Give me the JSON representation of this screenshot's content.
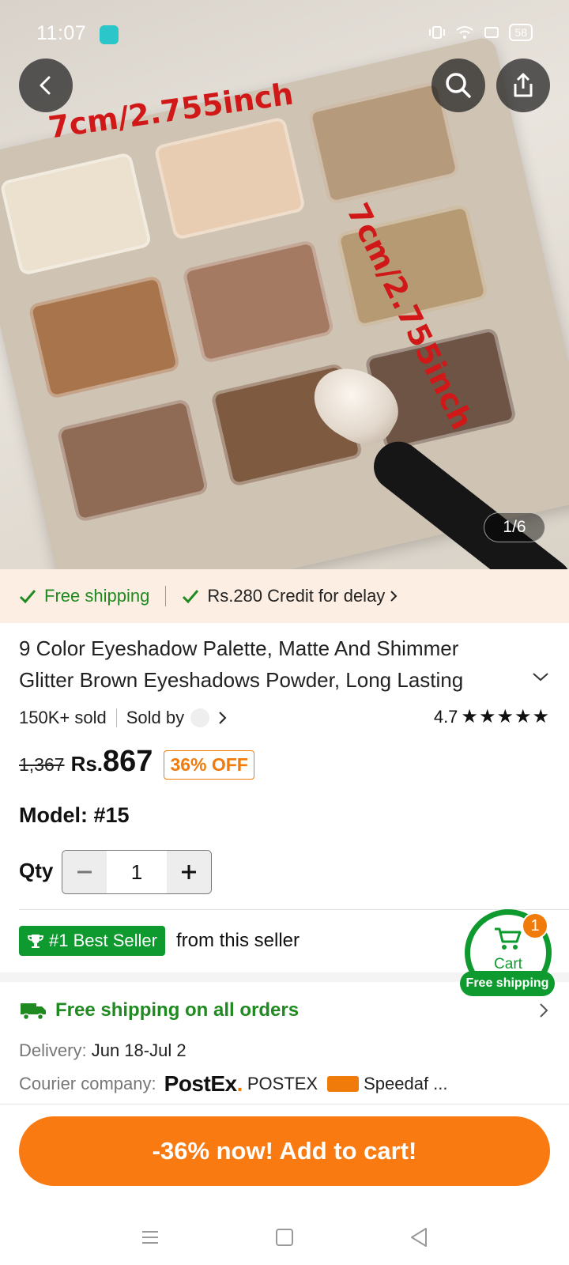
{
  "status_bar": {
    "time": "11:07",
    "battery": "58"
  },
  "hero": {
    "dimension_label_1": "7cm/2.755inch",
    "dimension_label_2": "7cm/2.755inch",
    "image_counter": "1/6"
  },
  "shipping_band": {
    "free_shipping": "Free shipping",
    "credit": "Rs.280 Credit for delay"
  },
  "product": {
    "title": "9 Color Eyeshadow Palette, Matte And Shimmer Glitter Brown Eyeshadows Powder, Long Lasting",
    "sold": "150K+ sold",
    "sold_by": "Sold by",
    "rating": "4.7",
    "original_price": "1,367",
    "currency": "Rs.",
    "price": "867",
    "discount": "36% OFF",
    "model": "Model: #15"
  },
  "quantity": {
    "label": "Qty",
    "value": "1"
  },
  "best_seller": {
    "badge": "#1 Best Seller",
    "suffix": "from this seller"
  },
  "floating_cart": {
    "label": "Cart",
    "count": "1",
    "free_shipping": "Free shipping"
  },
  "shipping_info": {
    "title": "Free shipping on all orders",
    "delivery_label": "Delivery:",
    "delivery_value": "Jun 18-Jul 2",
    "courier_label": "Courier company:",
    "postex_logo": "PostEx",
    "postex_name": "POSTEX",
    "speedaf_name": "Speedaf ..."
  },
  "cta": {
    "label": "-36% now! Add to cart!"
  },
  "colors": {
    "accent_orange": "#fa7a12",
    "accent_green": "#0e9a2f",
    "band_bg": "#fdeee3"
  },
  "icons": [
    "back-icon",
    "search-icon",
    "share-icon",
    "check-icon",
    "chevron-right-icon",
    "chevron-down-icon",
    "star-icon",
    "trophy-icon",
    "cart-icon",
    "truck-icon",
    "menu-icon",
    "home-icon",
    "back-nav-icon"
  ]
}
